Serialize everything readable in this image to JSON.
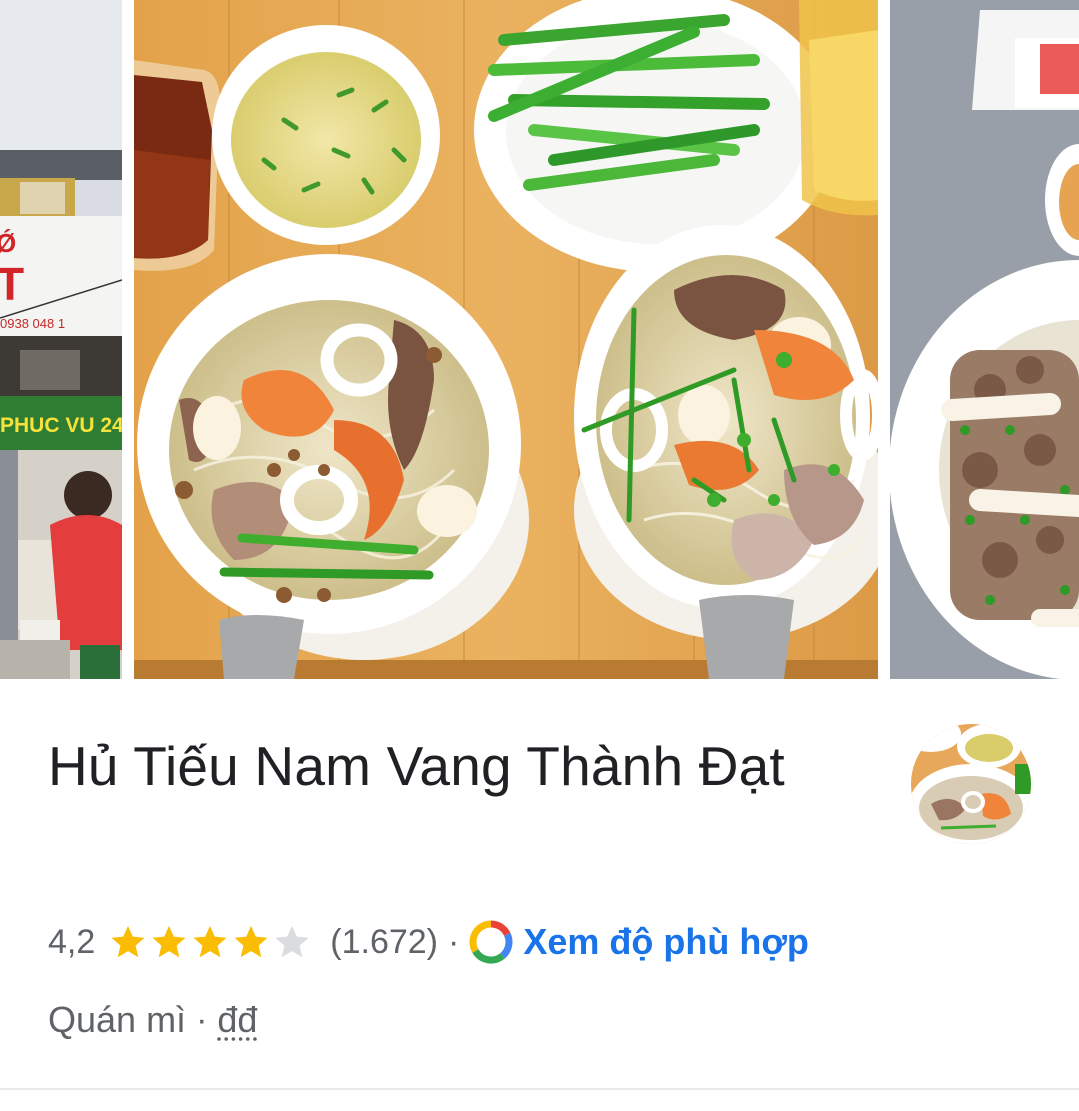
{
  "photos": [
    {
      "name": "storefront photo",
      "sign_phone": "0938 048 1",
      "sign_banner": "PHUC VU 24"
    },
    {
      "name": "dishes overhead photo"
    },
    {
      "name": "noodle bowl photo"
    }
  ],
  "place": {
    "title": "Hủ Tiếu Nam Vang Thành Đạt",
    "rating": "4,2",
    "star_score": 4.2,
    "star_max": 5,
    "review_count": "(1.672)",
    "separator": "·",
    "match_label": "Xem độ phù hợp",
    "category": "Quán mì",
    "price_level": "đđ"
  },
  "colors": {
    "title": "#202124",
    "secondary_text": "#5f6368",
    "link": "#1a73e8",
    "star_filled": "#fbbc04",
    "star_empty": "#dadce0",
    "divider": "#e8eaed"
  },
  "icons": {
    "match": "google-g-ring-icon",
    "star": "star-icon"
  }
}
